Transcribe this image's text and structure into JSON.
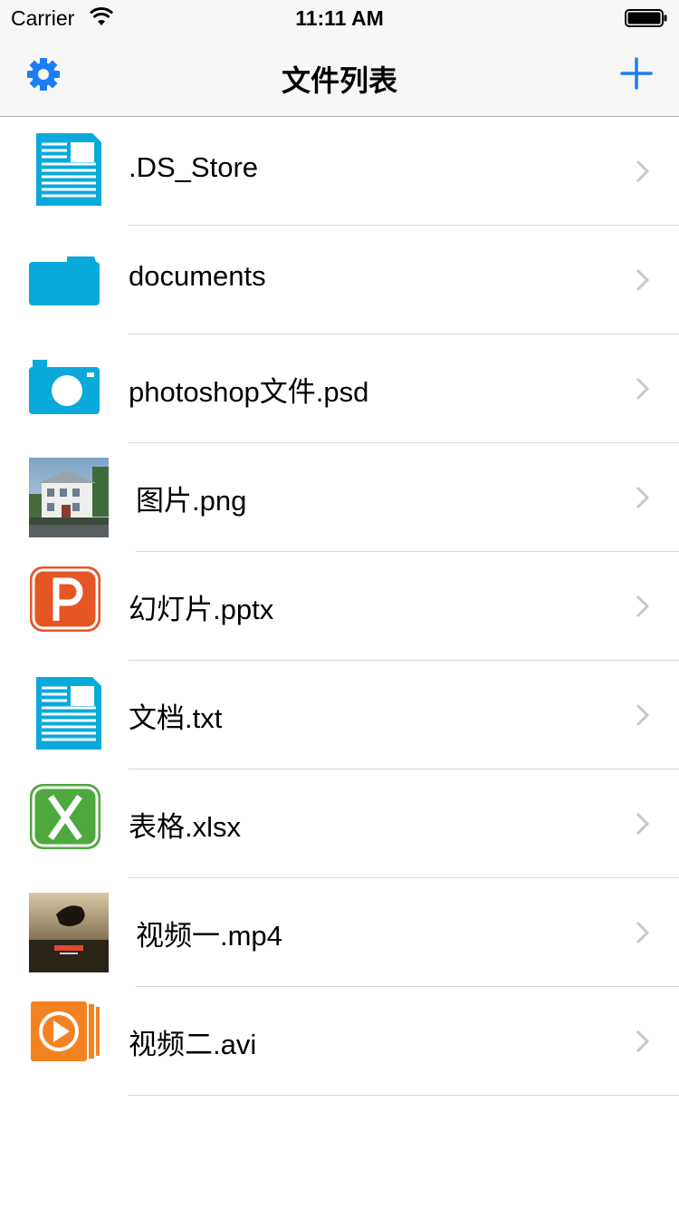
{
  "status_bar": {
    "carrier": "Carrier",
    "time": "11:11 AM"
  },
  "nav": {
    "title": "文件列表"
  },
  "files": [
    {
      "name": ".DS_Store",
      "icon": "document-icon"
    },
    {
      "name": "documents",
      "icon": "folder-icon"
    },
    {
      "name": "photoshop文件.psd",
      "icon": "camera-icon"
    },
    {
      "name": "图片.png",
      "icon": "image-thumbnail"
    },
    {
      "name": "幻灯片.pptx",
      "icon": "powerpoint-icon"
    },
    {
      "name": "文档.txt",
      "icon": "document-icon"
    },
    {
      "name": "表格.xlsx",
      "icon": "excel-icon"
    },
    {
      "name": "视频一.mp4",
      "icon": "video-thumbnail"
    },
    {
      "name": "视频二.avi",
      "icon": "video-play-icon"
    }
  ],
  "colors": {
    "accent": "#1a7ff5",
    "file_blue": "#0aa9dc",
    "ppt_orange": "#e65524",
    "excel_green": "#4ea83e",
    "video_orange": "#f58220"
  }
}
